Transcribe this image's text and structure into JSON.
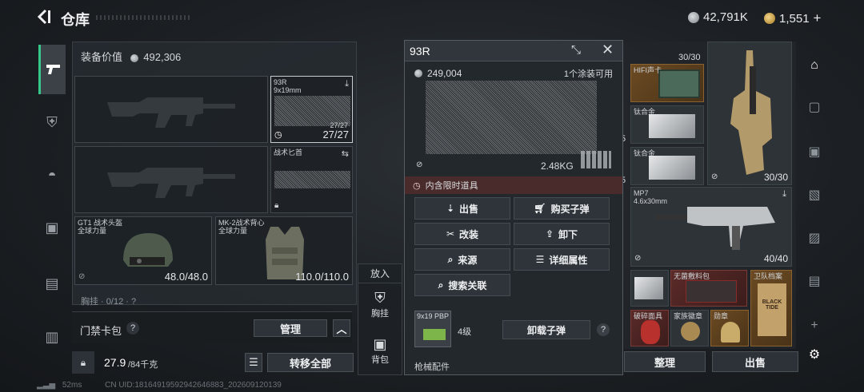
{
  "header": {
    "title": "仓库",
    "silver": "42,791K",
    "gold": "1,551",
    "plus": "+"
  },
  "equipment": {
    "value_label": "装备价值",
    "value": "492,306",
    "slots": {
      "pistol_name": "93R",
      "pistol_caliber": "9x19mm",
      "pistol_ammo_small": "27/27",
      "pistol_ammo": "27/27",
      "knife_name": "战术匕首",
      "helmet_name": "GT1 战术头盔",
      "helmet_faction": "全球力量",
      "helmet_durability": "48.0/48.0",
      "armor_name": "MK-2战术背心",
      "armor_faction": "全球力量",
      "armor_durability": "110.0/110.0",
      "chest_partial": "胸挂 · 0/12 · ?"
    }
  },
  "keybag": {
    "label": "门禁卡包",
    "help": "?",
    "manage": "管理"
  },
  "load": {
    "current": "27.9",
    "max": "/84千克",
    "transfer_all": "转移全部"
  },
  "putin": {
    "title": "放入",
    "chest": "胸挂",
    "backpack": "背包"
  },
  "popup": {
    "title": "93R",
    "price": "249,004",
    "skins": "1个涂装可用",
    "weight": "2.48KG",
    "timed_notice": "内含限时道具",
    "actions": {
      "sell": "出售",
      "buy_ammo": "购买子弹",
      "modify": "改装",
      "unequip": "卸下",
      "source": "来源",
      "details": "详细属性",
      "search": "搜索关联"
    },
    "ammo_name": "9x19 PBP",
    "ammo_level": "4级",
    "unload_ammo": "卸载子弹",
    "help": "?",
    "attachments": "枪械配件"
  },
  "grid": {
    "count_top": "30/30",
    "hifi": "HIFI声卡",
    "ti1": "钛合金",
    "ti2": "钛合金",
    "rifle_count": "30/30",
    "mp7_name": "MP7",
    "mp7_cal": "4.6x30mm",
    "mp7_count": "40/40",
    "num5a": "5",
    "num5b": "5",
    "drug": "无菌敷料包",
    "tape": "卫队档案",
    "black_tide": "BLACK TIDE",
    "mask": "破碎面具",
    "medal1": "家族徽章",
    "medal2": "勋章",
    "organize": "整理",
    "sell": "出售"
  },
  "status": {
    "ping": "52ms",
    "uid": "CN UID:1816491959294264688​3_202609120139"
  }
}
